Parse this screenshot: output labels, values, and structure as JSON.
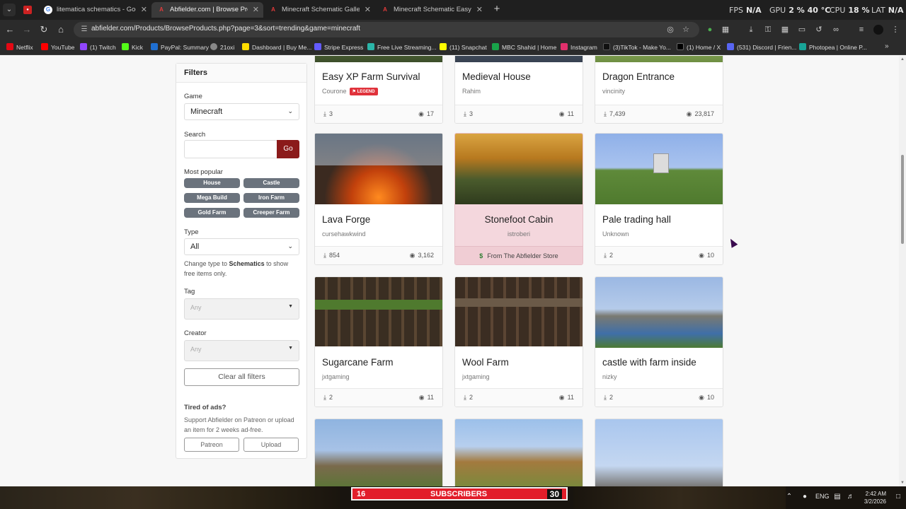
{
  "browser": {
    "tabs": [
      {
        "label": "",
        "favicon": "",
        "fav_color": "#cc2222",
        "active": false
      },
      {
        "label": "litematica schematics - Google",
        "favicon": "G",
        "fav_color": "#ffffff",
        "active": false
      },
      {
        "label": "Abfielder.com | Browse Product",
        "favicon": "A",
        "fav_color": "#d32f2f",
        "active": true
      },
      {
        "label": "Minecraft Schematic Galleon b",
        "favicon": "A",
        "fav_color": "#d32f2f",
        "active": false
      },
      {
        "label": "Minecraft Schematic Easy XP Fa",
        "favicon": "A",
        "fav_color": "#d32f2f",
        "active": false
      }
    ],
    "new_tab": "+",
    "perf": {
      "fps_label": "FPS",
      "fps_value": "N/A",
      "gpu_label": "GPU",
      "gpu_value": "2 %",
      "gpu_temp": "40 °C",
      "cpu_label": "CPU",
      "cpu_value": "18 %",
      "lat_label": "LAT",
      "lat_value": "N/A"
    },
    "url": "abfielder.com/Products/BrowseProducts.php?page=3&sort=trending&game=minecraft",
    "bookmarks": [
      {
        "label": "Netflix",
        "color": "#e50914"
      },
      {
        "label": "YouTube",
        "color": "#ff0000"
      },
      {
        "label": "(1) Twitch",
        "color": "#9146ff"
      },
      {
        "label": "Kick",
        "color": "#53fc18"
      },
      {
        "label": "PayPal: Summary",
        "color": "#1f6fd1"
      },
      {
        "label": "21oxi",
        "color": "#888888"
      },
      {
        "label": "Dashboard | Buy Me...",
        "color": "#ffdd00"
      },
      {
        "label": "Stripe Express",
        "color": "#635bff"
      },
      {
        "label": "Free Live Streaming...",
        "color": "#2bb5a8"
      },
      {
        "label": "(11) Snapchat",
        "color": "#fffc00"
      },
      {
        "label": "MBC Shahid | Home",
        "color": "#19a34a"
      },
      {
        "label": "Instagram",
        "color": "#e1306c"
      },
      {
        "label": "(3)TikTok - Make Yo...",
        "color": "#111111"
      },
      {
        "label": "(1) Home / X",
        "color": "#000000"
      },
      {
        "label": "(531) Discord | Frien...",
        "color": "#5865f2"
      },
      {
        "label": "Photopea | Online P...",
        "color": "#18a497"
      }
    ]
  },
  "filters": {
    "title": "Filters",
    "game_label": "Game",
    "game_value": "Minecraft",
    "search_label": "Search",
    "search_value": "",
    "go_label": "Go",
    "popular_label": "Most popular",
    "popular_tags": [
      "House",
      "Castle",
      "Mega Build",
      "Iron Farm",
      "Gold Farm",
      "Creeper Farm"
    ],
    "type_label": "Type",
    "type_value": "All",
    "type_help_pre": "Change type to ",
    "type_help_bold": "Schematics",
    "type_help_post": " to show free items only.",
    "tag_label": "Tag",
    "tag_value": "Any",
    "creator_label": "Creator",
    "creator_value": "Any",
    "clear_label": "Clear all filters",
    "ads_title": "Tired of ads?",
    "ads_text": "Support Abfielder on Patreon or upload an item for 2 weeks ad-free.",
    "patreon_label": "Patreon",
    "upload_label": "Upload"
  },
  "products": [
    {
      "title": "Easy XP Farm Survival",
      "author": "Courone",
      "badge": "LEGEND",
      "downloads": "3",
      "views": "17",
      "store": false
    },
    {
      "title": "Medieval House",
      "author": "Rahim",
      "badge": "",
      "downloads": "3",
      "views": "11",
      "store": false
    },
    {
      "title": "Dragon Entrance",
      "author": "vincinity",
      "badge": "",
      "downloads": "7,439",
      "views": "23,817",
      "store": false
    },
    {
      "title": "Lava Forge",
      "author": "cursehawkwind",
      "badge": "",
      "downloads": "854",
      "views": "3,162",
      "store": false
    },
    {
      "title": "Stonefoot Cabin",
      "author": "istroberi",
      "badge": "",
      "store_label": "From The Abfielder Store",
      "store": true
    },
    {
      "title": "Pale trading hall",
      "author": "Unknown",
      "badge": "",
      "downloads": "2",
      "views": "10",
      "store": false
    },
    {
      "title": "Sugarcane Farm",
      "author": "jxtgaming",
      "badge": "",
      "downloads": "2",
      "views": "11",
      "store": false
    },
    {
      "title": "Wool Farm",
      "author": "jxtgaming",
      "badge": "",
      "downloads": "2",
      "views": "11",
      "store": false
    },
    {
      "title": "castle with farm inside",
      "author": "nizky",
      "badge": "",
      "downloads": "2",
      "views": "10",
      "store": false
    }
  ],
  "taskbar": {
    "subs_left": "16",
    "subs_label": "SUBSCRIBERS",
    "subs_right": "30",
    "lang": "ENG",
    "time": "2:42 AM",
    "date": "3/2/2026"
  }
}
